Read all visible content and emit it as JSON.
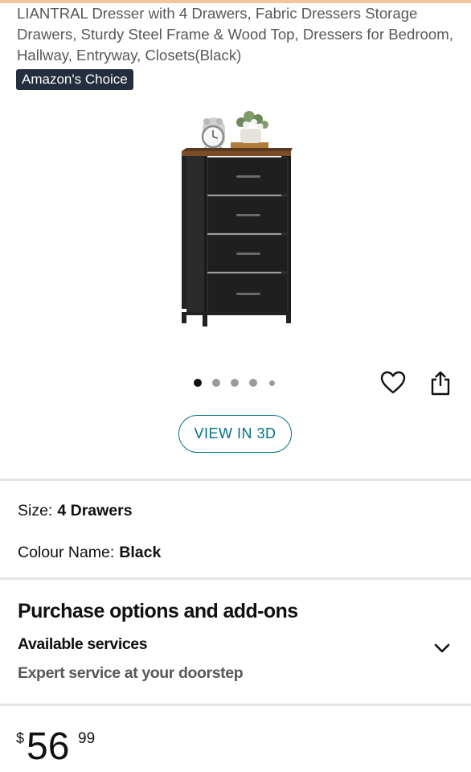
{
  "product": {
    "title": "LIANTRAL Dresser with 4 Drawers, Fabric Dressers Storage Drawers, Sturdy Steel Frame & Wood Top, Dressers for Bedroom, Hallway, Entryway, Closets(Black)",
    "badge": "Amazon's Choice"
  },
  "gallery": {
    "image_count": 5,
    "active_index": 0,
    "view_3d_label": "VIEW IN 3D",
    "wishlist_icon": "heart-icon",
    "share_icon": "share-icon"
  },
  "variations": {
    "size_label": "Size:",
    "size_value": "4 Drawers",
    "colour_label": "Colour Name:",
    "colour_value": "Black"
  },
  "purchase_options": {
    "title": "Purchase options and add-ons",
    "services_title": "Available services",
    "services_subtitle": "Expert service at your doorstep",
    "expand_icon": "chevron-down-icon"
  },
  "price": {
    "symbol": "$",
    "whole": "56",
    "fraction": "99"
  },
  "colors": {
    "link": "#007185",
    "badge_bg": "#232f3e",
    "text": "#0f1111",
    "secondary_text": "#565959",
    "top_accent": "#f3c79a"
  }
}
